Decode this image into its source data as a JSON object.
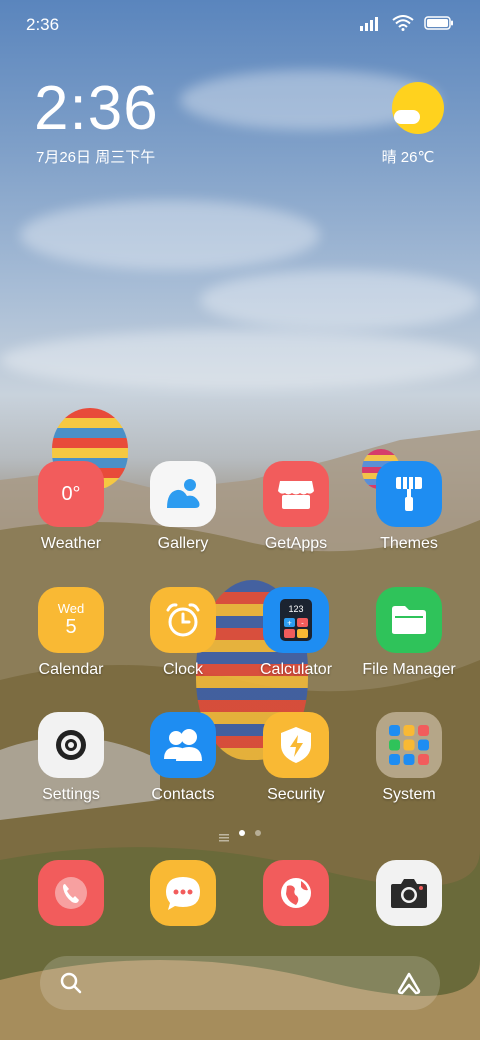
{
  "status": {
    "time": "2:36",
    "icons": [
      "signal-icon",
      "wifi-icon",
      "battery-icon"
    ]
  },
  "clock_widget": {
    "time": "2:36",
    "date": "7月26日 周三下午"
  },
  "weather_widget": {
    "text": "晴 26℃",
    "icon": "sunny-cloud-icon"
  },
  "apps": [
    {
      "label": "Weather",
      "icon_text": "0°",
      "color": "#f25c5c"
    },
    {
      "label": "Gallery",
      "color": "#f6f6f6"
    },
    {
      "label": "GetApps",
      "color": "#f25c5c"
    },
    {
      "label": "Themes",
      "color": "#1e8df2"
    },
    {
      "label": "Calendar",
      "icon_day": "Wed",
      "icon_date": "5",
      "color": "#f9b934"
    },
    {
      "label": "Clock",
      "color": "#f9b934"
    },
    {
      "label": "Calculator",
      "icon_text": "123",
      "color": "#1e8df2"
    },
    {
      "label": "File Manager",
      "color": "#2fc35a"
    },
    {
      "label": "Settings",
      "color": "#f2f2f2"
    },
    {
      "label": "Contacts",
      "color": "#1e8df2"
    },
    {
      "label": "Security",
      "color": "#f9b934"
    },
    {
      "label": "System",
      "color": "#b8aa92"
    }
  ],
  "dock": [
    {
      "name": "phone",
      "color": "#f25c5c"
    },
    {
      "name": "messages",
      "color": "#f9b934"
    },
    {
      "name": "browser",
      "color": "#f25c5c"
    },
    {
      "name": "camera",
      "color": "#f2f2f2"
    }
  ],
  "page_indicator": {
    "pages": 2,
    "current": 1
  }
}
